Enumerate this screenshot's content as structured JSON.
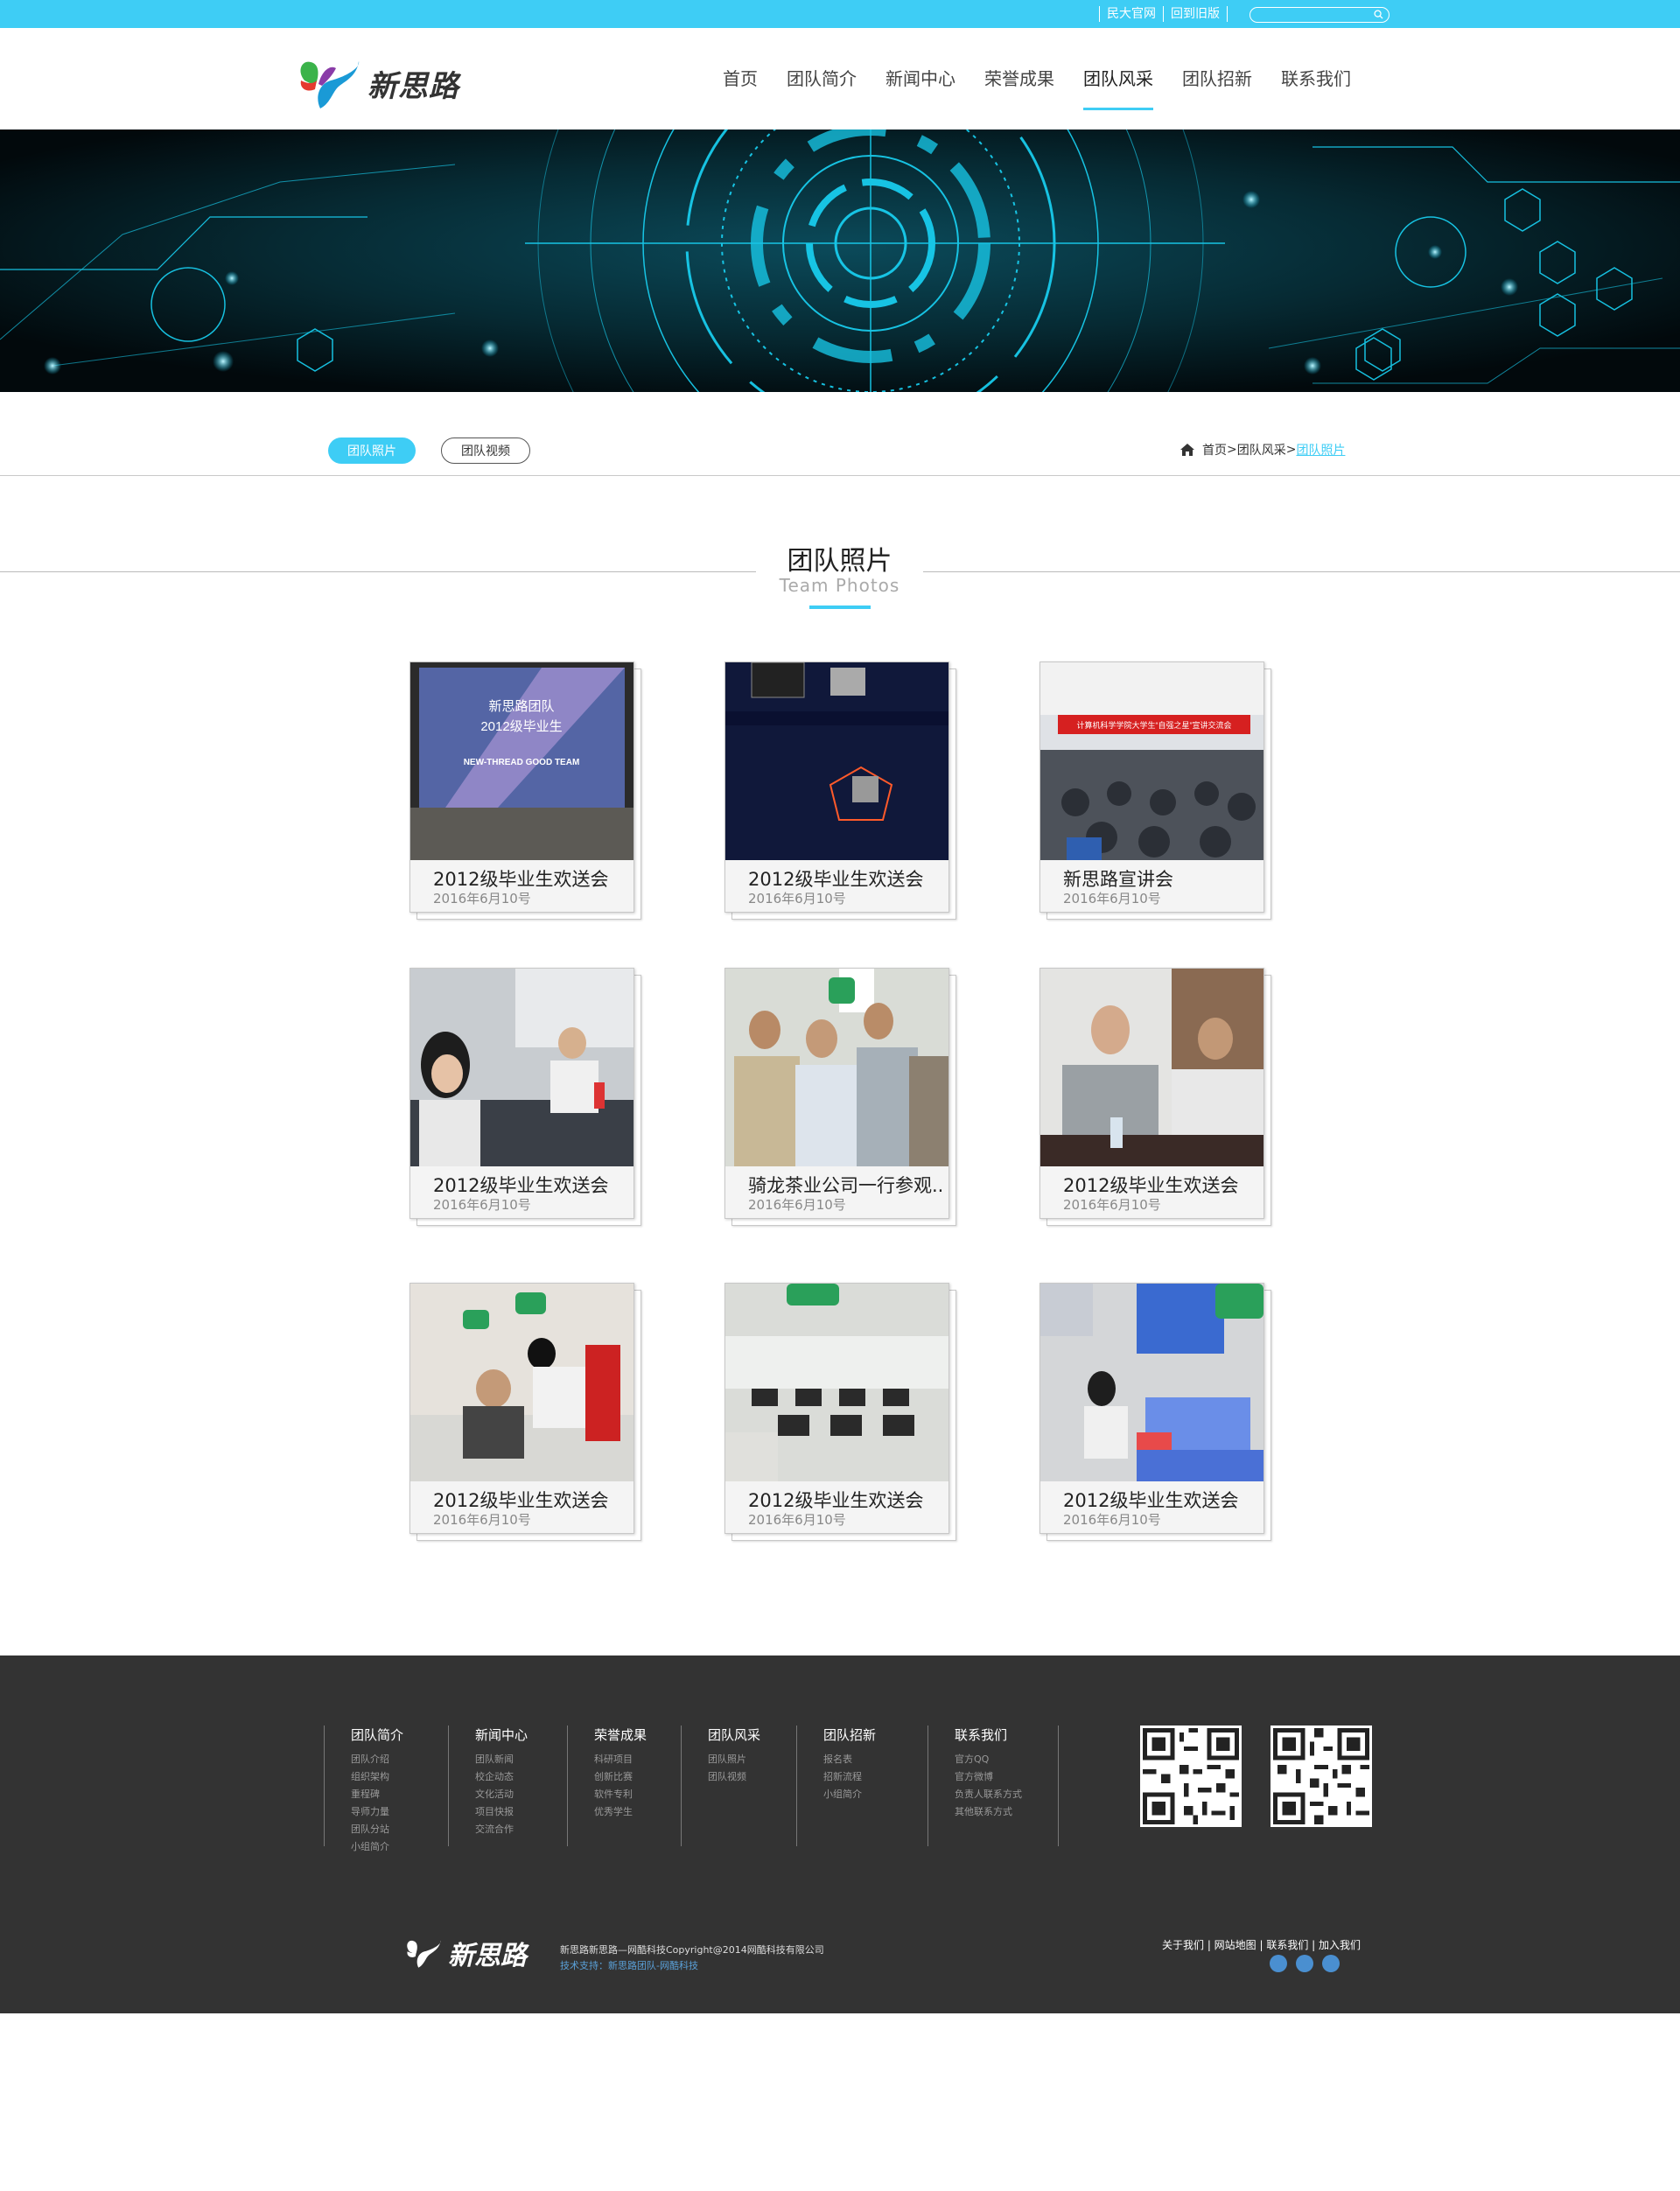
{
  "topbar": {
    "links": [
      "民大官网",
      "回到旧版"
    ],
    "search_placeholder": ""
  },
  "header": {
    "logo_text": "新思路",
    "nav": [
      "首页",
      "团队简介",
      "新闻中心",
      "荣誉成果",
      "团队风采",
      "团队招新",
      "联系我们"
    ],
    "active_nav": "团队风采"
  },
  "subnav": {
    "tabs": [
      "团队照片",
      "团队视频"
    ],
    "active_tab": "团队照片",
    "breadcrumb": {
      "home": "首页",
      "sep": ">",
      "section": "团队风采",
      "current": "团队照片"
    }
  },
  "section": {
    "title": "团队照片",
    "subtitle": "Team Photos"
  },
  "photos": [
    {
      "caption": "2012级毕业生欢送会",
      "date": "2016年6月10号"
    },
    {
      "caption": "2012级毕业生欢送会",
      "date": "2016年6月10号"
    },
    {
      "caption": "新思路宣讲会",
      "date": "2016年6月10号"
    },
    {
      "caption": "2012级毕业生欢送会",
      "date": "2016年6月10号"
    },
    {
      "caption": "骑龙茶业公司一行参观..",
      "date": "2016年6月10号"
    },
    {
      "caption": "2012级毕业生欢送会",
      "date": "2016年6月10号"
    },
    {
      "caption": "2012级毕业生欢送会",
      "date": "2016年6月10号"
    },
    {
      "caption": "2012级毕业生欢送会",
      "date": "2016年6月10号"
    },
    {
      "caption": "2012级毕业生欢送会",
      "date": "2016年6月10号"
    }
  ],
  "photo_texts": {
    "slide_line1": "新思路团队",
    "slide_line2": "2012级毕业生",
    "slide_line3": "NEW-THREAD GOOD TEAM",
    "banner_sign": "计算机科学学院大学生“自强之星”宣讲交流会"
  },
  "footer": {
    "columns": [
      {
        "title": "团队简介",
        "items": [
          "团队介绍",
          "组织架构",
          "重程碑",
          "导师力量",
          "团队分站",
          "小组简介"
        ]
      },
      {
        "title": "新闻中心",
        "items": [
          "团队新闻",
          "校企动态",
          "文化活动",
          "项目快报",
          "交流合作"
        ]
      },
      {
        "title": "荣誉成果",
        "items": [
          "科研项目",
          "创新比赛",
          "软件专利",
          "优秀学生"
        ]
      },
      {
        "title": "团队风采",
        "items": [
          "团队照片",
          "团队视频"
        ]
      },
      {
        "title": "团队招新",
        "items": [
          "报名表",
          "招新流程",
          "小组简介"
        ]
      },
      {
        "title": "联系我们",
        "items": [
          "官方QQ",
          "官方微博",
          "负责人联系方式",
          "其他联系方式"
        ]
      }
    ],
    "logo_text": "新思路",
    "copyright": "新思路新思路—网酷科技Copyright@2014网酷科技有限公司",
    "tech_support": "技术支持：新思路团队-网酷科技",
    "links": "关于我们 | 网站地图 | 联系我们 | 加入我们"
  },
  "colors": {
    "accent": "#3ecdf5",
    "footer_bg": "#333333",
    "banner_bg": "#041318"
  }
}
